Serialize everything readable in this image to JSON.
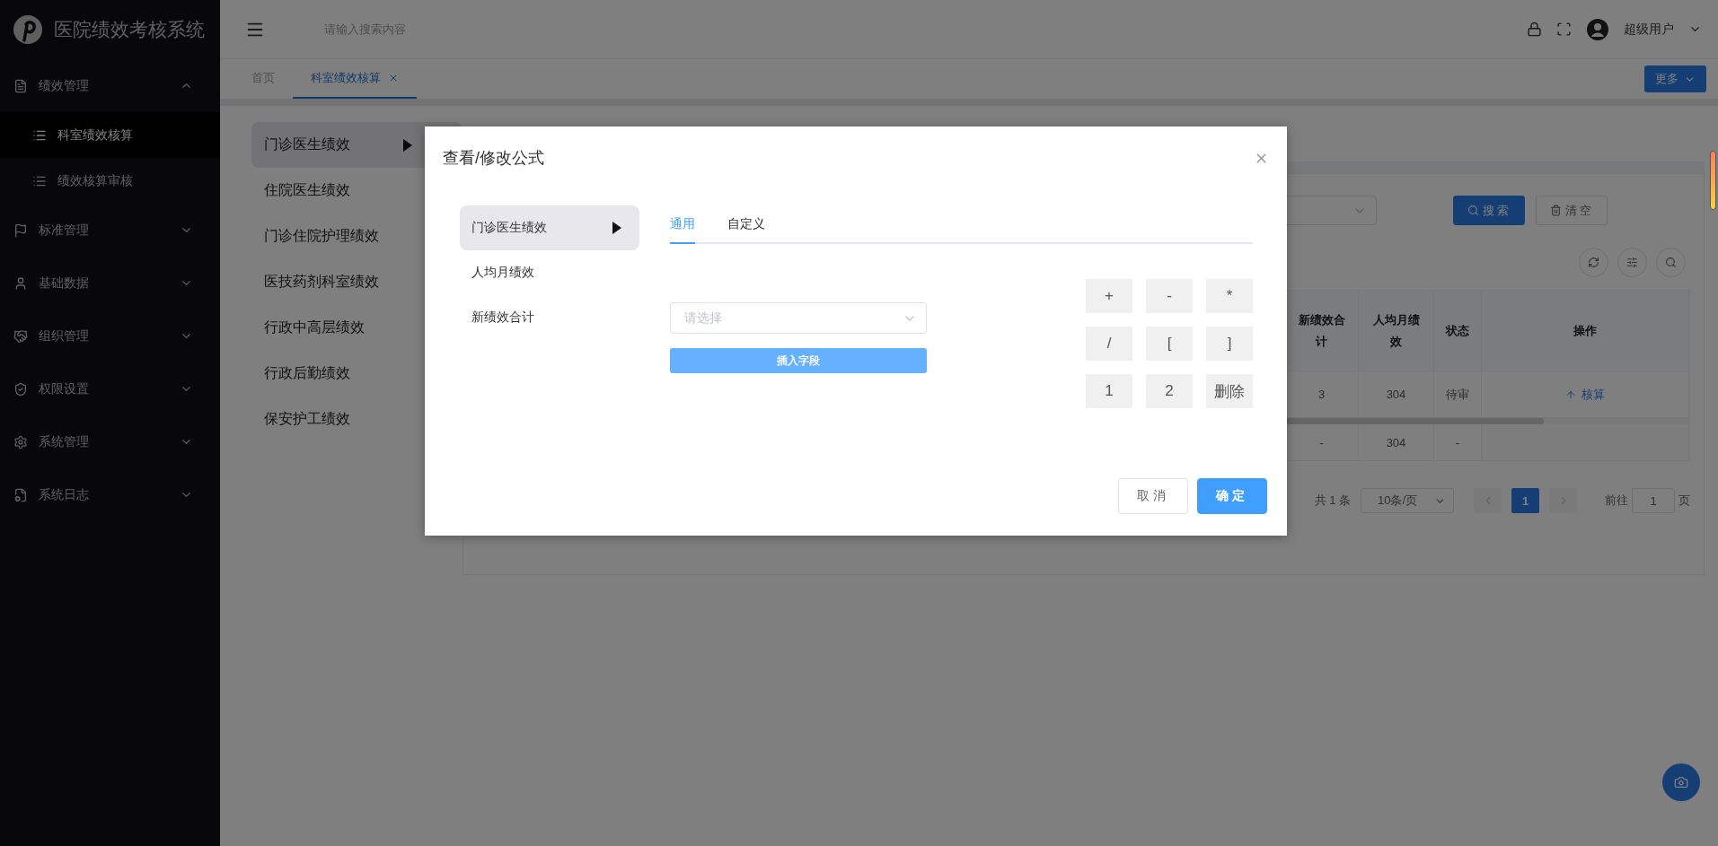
{
  "sidebar": {
    "title": "医院绩效考核系统",
    "items": [
      {
        "label": "绩效管理",
        "expanded": true,
        "children": [
          {
            "label": "科室绩效核算",
            "selected": true
          },
          {
            "label": "绩效核算审核",
            "selected": false
          }
        ]
      },
      {
        "label": "标准管理",
        "expanded": false
      },
      {
        "label": "基础数据",
        "expanded": false
      },
      {
        "label": "组织管理",
        "expanded": false
      },
      {
        "label": "权限设置",
        "expanded": false
      },
      {
        "label": "系统管理",
        "expanded": false
      },
      {
        "label": "系统日志",
        "expanded": false
      }
    ]
  },
  "header": {
    "search": {
      "placeholder": "请输入搜索内容"
    },
    "user": "超级用户"
  },
  "tabs": [
    {
      "label": "首页",
      "selected": false,
      "closable": false
    },
    {
      "label": "科室绩效核算",
      "selected": true,
      "closable": true
    }
  ],
  "more_button": "更多",
  "categories": [
    {
      "label": "门诊医生绩效",
      "selected": true
    },
    {
      "label": "住院医生绩效",
      "selected": false
    },
    {
      "label": "门诊住院护理绩效",
      "selected": false
    },
    {
      "label": "医技药剂科室绩效",
      "selected": false
    },
    {
      "label": "行政中高层绩效",
      "selected": false
    },
    {
      "label": "行政后勤绩效",
      "selected": false
    },
    {
      "label": "保安护工绩效",
      "selected": false
    }
  ],
  "filter": {
    "search_button": "搜索",
    "clear_button": "清空"
  },
  "table": {
    "columns": [
      "新绩效合计",
      "人均月绩效",
      "状态",
      "操作"
    ],
    "rows": [
      {
        "cells": [
          "3",
          "304",
          "待审"
        ],
        "action": "核算"
      }
    ],
    "summary": [
      "-",
      "304",
      "-"
    ]
  },
  "pagination": {
    "total": "共 1 条",
    "page_size": "10条/页",
    "pages": [
      {
        "label": "1",
        "selected": true
      }
    ],
    "goto_label": "前往",
    "goto_value": "1",
    "goto_suffix": "页"
  },
  "dialog": {
    "title": "查看/修改公式",
    "items": [
      {
        "label": "门诊医生绩效",
        "selected": true
      },
      {
        "label": "人均月绩效",
        "selected": false
      },
      {
        "label": "新绩效合计",
        "selected": false
      }
    ],
    "tabs": [
      {
        "label": "通用",
        "selected": true
      },
      {
        "label": "自定义",
        "selected": false
      }
    ],
    "select": {
      "placeholder": "请选择"
    },
    "insert_button": "插入字段",
    "keys": [
      "+",
      "-",
      "*",
      "/",
      "[",
      "]",
      "1",
      "2",
      "删除"
    ],
    "cancel": "取消",
    "confirm": "确定"
  }
}
